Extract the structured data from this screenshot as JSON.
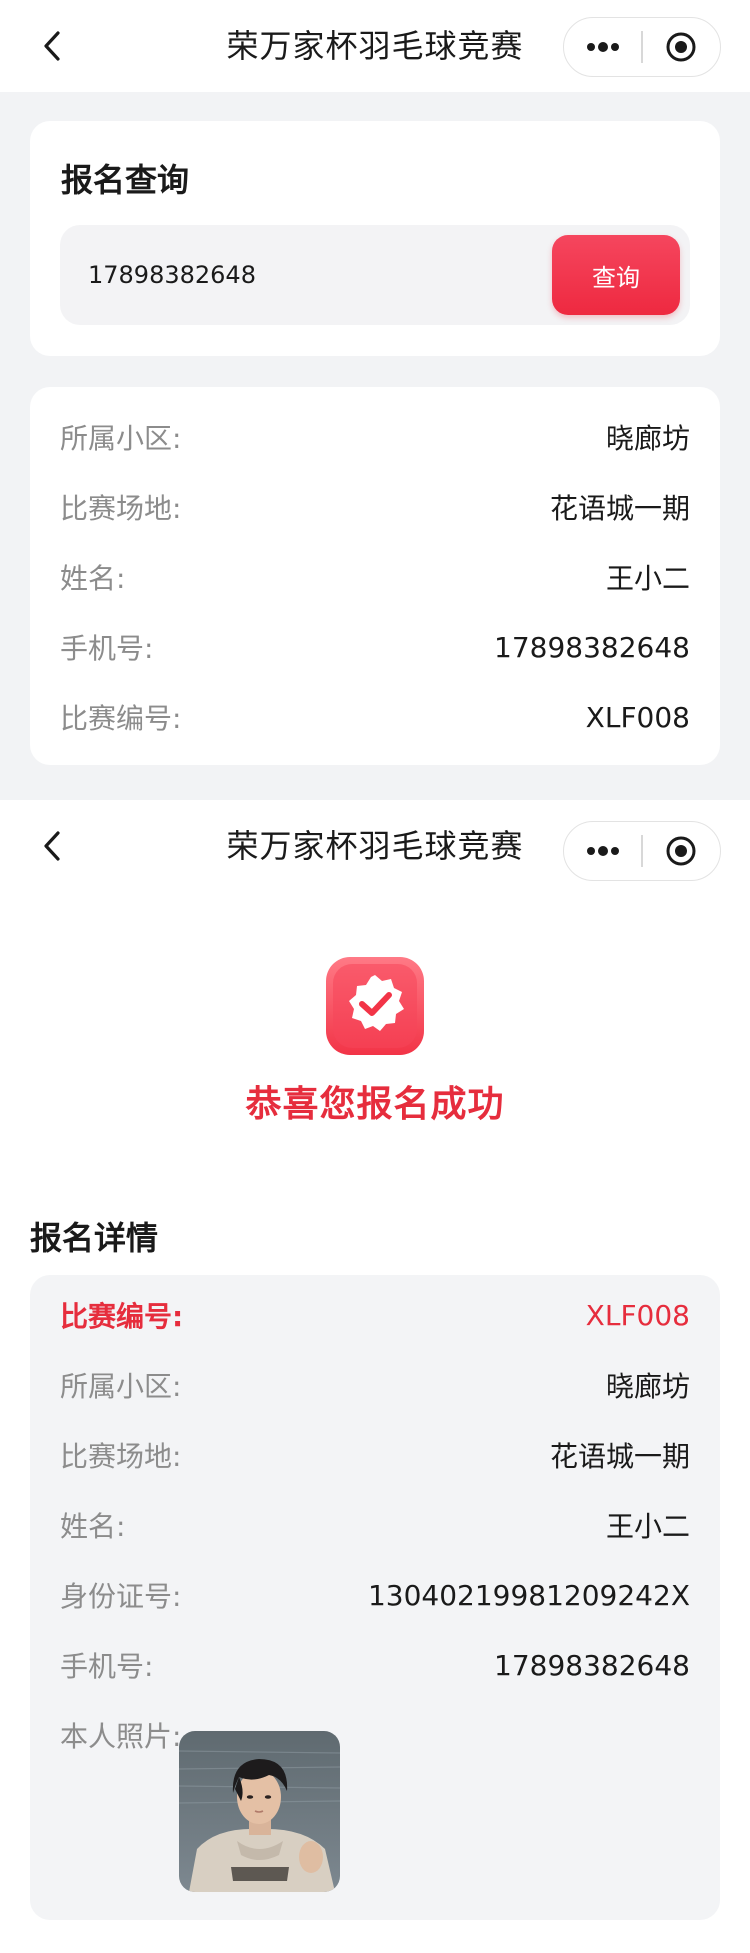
{
  "nav": {
    "title": "荣万家杯羽毛球竞赛"
  },
  "query": {
    "title": "报名查询",
    "input_value": "17898382648",
    "button_label": "查询"
  },
  "query_result": {
    "rows": [
      {
        "label": "所属小区:",
        "value": "晓廊坊"
      },
      {
        "label": "比赛场地:",
        "value": "花语城一期"
      },
      {
        "label": "姓名:",
        "value": "王小二"
      },
      {
        "label": "手机号:",
        "value": "17898382648"
      },
      {
        "label": "比赛编号:",
        "value": "XLF008"
      }
    ]
  },
  "success": {
    "message": "恭喜您报名成功",
    "icon": "badge-check-icon"
  },
  "details": {
    "title": "报名详情",
    "match_no_label": "比赛编号:",
    "match_no_value": "XLF008",
    "rows": [
      {
        "label": "所属小区:",
        "value": "晓廊坊"
      },
      {
        "label": "比赛场地:",
        "value": "花语城一期"
      },
      {
        "label": "姓名:",
        "value": "王小二"
      },
      {
        "label": "身份证号:",
        "value": "13040219981209242X"
      },
      {
        "label": "手机号:",
        "value": "17898382648"
      }
    ],
    "photo_label": "本人照片:"
  },
  "colors": {
    "accent": "#e62d3d",
    "page_bg": "#f2f3f5",
    "detail_bg": "#f3f4f6"
  }
}
